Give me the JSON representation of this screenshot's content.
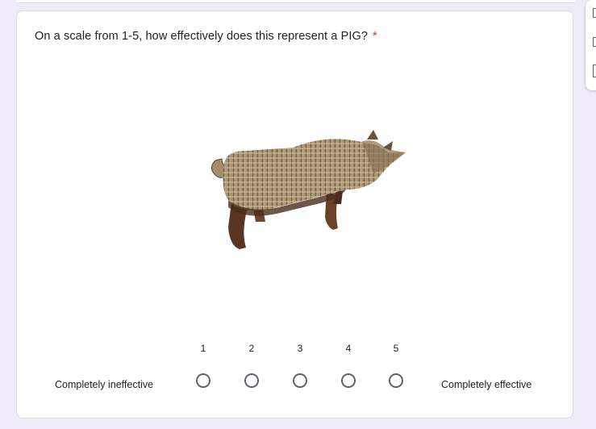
{
  "question": {
    "text": "On a scale from 1-5, how effectively does this represent a PIG?",
    "required_marker": "*"
  },
  "image": {
    "subject": "pig-figure-image"
  },
  "scale": {
    "numbers": [
      "1",
      "2",
      "3",
      "4",
      "5"
    ],
    "low_label": "Completely ineffective",
    "high_label": "Completely effective",
    "selected": null
  },
  "colors": {
    "page_background": "#f0ebf8",
    "required": "#d93025",
    "radio_border": "#5f6368"
  },
  "icons": [
    "add-question-icon",
    "add-title-icon",
    "add-section-icon"
  ]
}
